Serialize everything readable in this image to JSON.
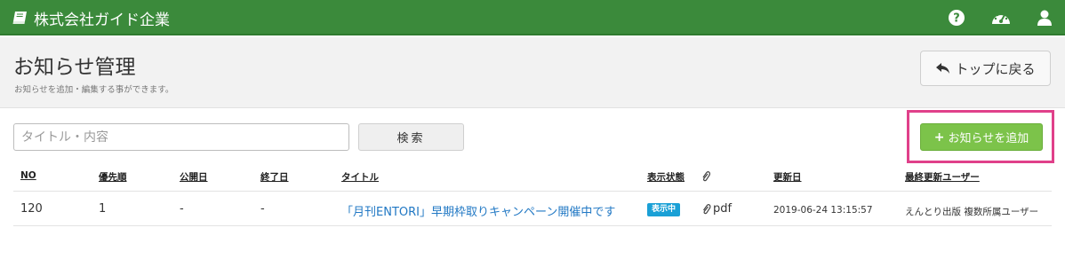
{
  "topbar": {
    "brand": "株式会社ガイド企業",
    "icons": [
      "help-icon",
      "dashboard-icon",
      "user-icon"
    ]
  },
  "header": {
    "title": "お知らせ管理",
    "subtitle": "お知らせを追加・編集する事ができます。",
    "back_button": "トップに戻る"
  },
  "toolbar": {
    "search_placeholder": "タイトル・内容",
    "search_value": "",
    "search_button": "検索",
    "add_button": "お知らせを追加"
  },
  "table": {
    "columns": [
      "NO",
      "優先順",
      "公開日",
      "終了日",
      "タイトル",
      "表示状態",
      "更新日",
      "最終更新ユーザー"
    ],
    "rows": [
      {
        "no": "120",
        "priority": "1",
        "publish_date": "-",
        "end_date": "-",
        "title": "「月刊ENTORI」早期枠取りキャンペーン開催中です",
        "status": "表示中",
        "attachment": "pdf",
        "updated": "2019-06-24 13:15:57",
        "last_user": "えんとり出版 複数所属ユーザー"
      }
    ]
  },
  "colors": {
    "topbar": "#3b8a3b",
    "add_button": "#7cc34a",
    "highlight": "#e0408a",
    "link": "#2178c4",
    "status_badge": "#1aa0d6"
  }
}
